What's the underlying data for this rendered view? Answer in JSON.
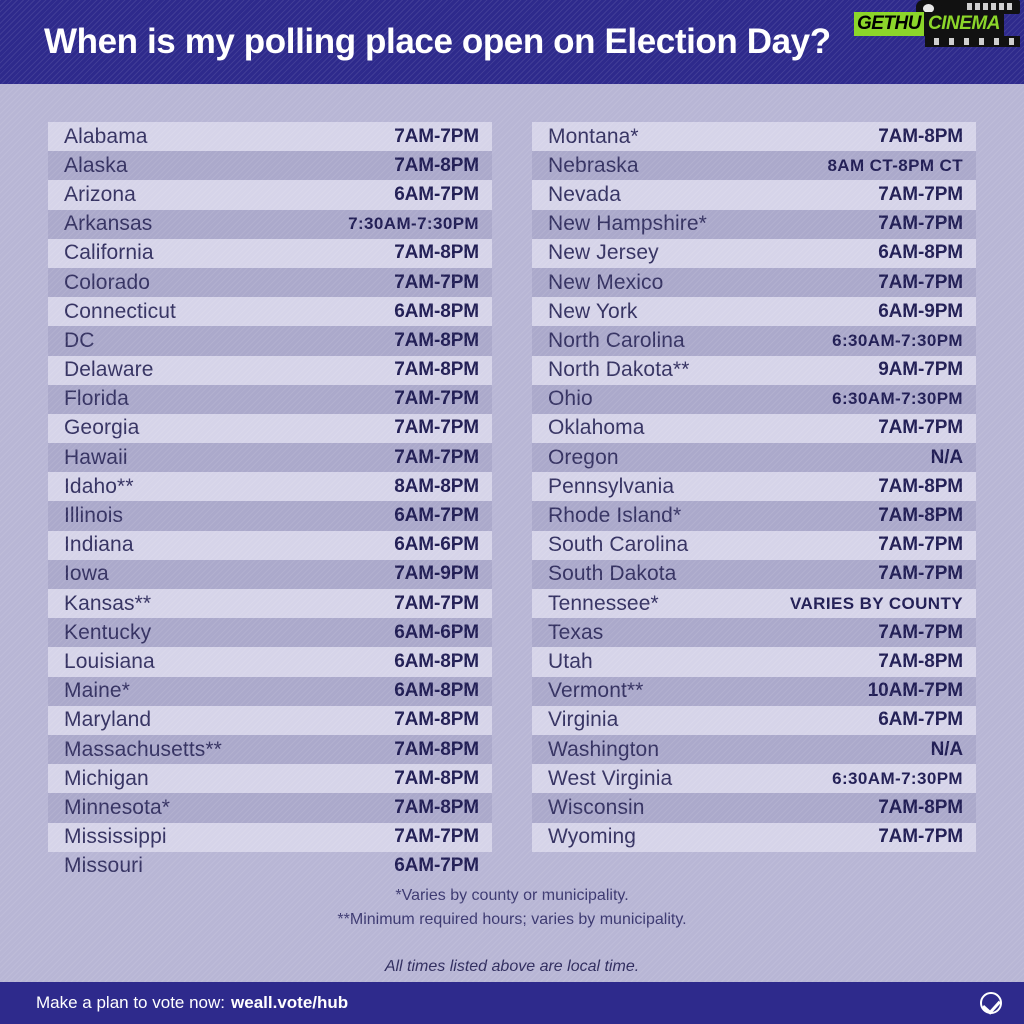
{
  "header": {
    "title": "When is my polling place open on Election Day?"
  },
  "watermark": {
    "brand_first": "GETHU",
    "brand_second": "CINEMA"
  },
  "colors": {
    "header_bg": "#2e2a8c",
    "page_bg": "#b8b6d5",
    "row_light": "#e8e7f5",
    "row_dark": "#8c89b4",
    "state_text": "#353262",
    "hours_text": "#201d54",
    "footer_bg": "#2e2a8c",
    "watermark_green": "#8cd62a"
  },
  "table": {
    "left_column": [
      {
        "state": "Alabama",
        "hours": "7AM-7PM"
      },
      {
        "state": "Alaska",
        "hours": "7AM-8PM"
      },
      {
        "state": "Arizona",
        "hours": "6AM-7PM"
      },
      {
        "state": "Arkansas",
        "hours": "7:30AM-7:30PM"
      },
      {
        "state": "California",
        "hours": "7AM-8PM"
      },
      {
        "state": "Colorado",
        "hours": "7AM-7PM"
      },
      {
        "state": "Connecticut",
        "hours": "6AM-8PM"
      },
      {
        "state": "DC",
        "hours": "7AM-8PM"
      },
      {
        "state": "Delaware",
        "hours": "7AM-8PM"
      },
      {
        "state": "Florida",
        "hours": "7AM-7PM"
      },
      {
        "state": "Georgia",
        "hours": "7AM-7PM"
      },
      {
        "state": "Hawaii",
        "hours": "7AM-7PM"
      },
      {
        "state": "Idaho**",
        "hours": "8AM-8PM"
      },
      {
        "state": "Illinois",
        "hours": "6AM-7PM"
      },
      {
        "state": "Indiana",
        "hours": "6AM-6PM"
      },
      {
        "state": "Iowa",
        "hours": "7AM-9PM"
      },
      {
        "state": "Kansas**",
        "hours": "7AM-7PM"
      },
      {
        "state": "Kentucky",
        "hours": "6AM-6PM"
      },
      {
        "state": "Louisiana",
        "hours": "6AM-8PM"
      },
      {
        "state": "Maine*",
        "hours": "6AM-8PM"
      },
      {
        "state": "Maryland",
        "hours": "7AM-8PM"
      },
      {
        "state": "Massachusetts**",
        "hours": "7AM-8PM"
      },
      {
        "state": "Michigan",
        "hours": "7AM-8PM"
      },
      {
        "state": "Minnesota*",
        "hours": "7AM-8PM"
      },
      {
        "state": "Mississippi",
        "hours": "7AM-7PM"
      },
      {
        "state": "Missouri",
        "hours": "6AM-7PM"
      }
    ],
    "right_column": [
      {
        "state": "Montana*",
        "hours": "7AM-8PM"
      },
      {
        "state": "Nebraska",
        "hours": "8AM CT-8PM CT"
      },
      {
        "state": "Nevada",
        "hours": "7AM-7PM"
      },
      {
        "state": "New Hampshire*",
        "hours": "7AM-7PM"
      },
      {
        "state": "New Jersey",
        "hours": "6AM-8PM"
      },
      {
        "state": "New Mexico",
        "hours": "7AM-7PM"
      },
      {
        "state": "New York",
        "hours": "6AM-9PM"
      },
      {
        "state": "North Carolina",
        "hours": "6:30AM-7:30PM"
      },
      {
        "state": "North Dakota**",
        "hours": "9AM-7PM"
      },
      {
        "state": "Ohio",
        "hours": "6:30AM-7:30PM"
      },
      {
        "state": "Oklahoma",
        "hours": "7AM-7PM"
      },
      {
        "state": "Oregon",
        "hours": "N/A"
      },
      {
        "state": "Pennsylvania",
        "hours": "7AM-8PM"
      },
      {
        "state": "Rhode Island*",
        "hours": "7AM-8PM"
      },
      {
        "state": "South Carolina",
        "hours": "7AM-7PM"
      },
      {
        "state": "South Dakota",
        "hours": "7AM-7PM"
      },
      {
        "state": "Tennessee*",
        "hours": "VARIES BY COUNTY"
      },
      {
        "state": "Texas",
        "hours": "7AM-7PM"
      },
      {
        "state": "Utah",
        "hours": "7AM-8PM"
      },
      {
        "state": "Vermont**",
        "hours": "10AM-7PM"
      },
      {
        "state": "Virginia",
        "hours": "6AM-7PM"
      },
      {
        "state": "Washington",
        "hours": "N/A"
      },
      {
        "state": "West Virginia",
        "hours": "6:30AM-7:30PM"
      },
      {
        "state": "Wisconsin",
        "hours": "7AM-8PM"
      },
      {
        "state": "Wyoming",
        "hours": "7AM-7PM"
      }
    ]
  },
  "notes": {
    "single_star": "*Varies by county or municipality.",
    "double_star": "**Minimum required hours; varies by municipality.",
    "local_time": "All times listed above are local time."
  },
  "footer": {
    "cta": "Make a plan to vote now:",
    "url": "weall.vote/hub",
    "logo": "check-circle-icon"
  }
}
